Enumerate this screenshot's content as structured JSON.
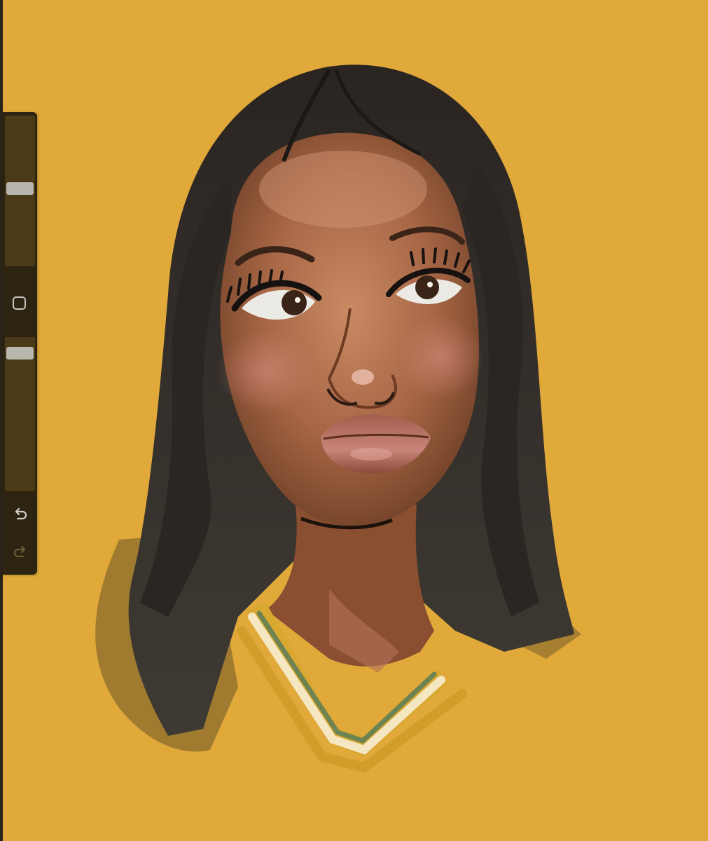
{
  "canvas": {
    "background": "#e0a93a"
  },
  "sidebar": {
    "background": "#2c2410",
    "track_color": "#4a3a17",
    "thumb_color": "#b9b6ae",
    "brush_size": {
      "level": 0.52,
      "icon": "brush-size-slider"
    },
    "brush_opacity": {
      "level": 0.06,
      "icon": "brush-opacity-slider"
    },
    "modify_icon": "square-modify-icon",
    "undo_icon": "undo-arrow-icon",
    "redo_icon": "redo-arrow-icon"
  }
}
